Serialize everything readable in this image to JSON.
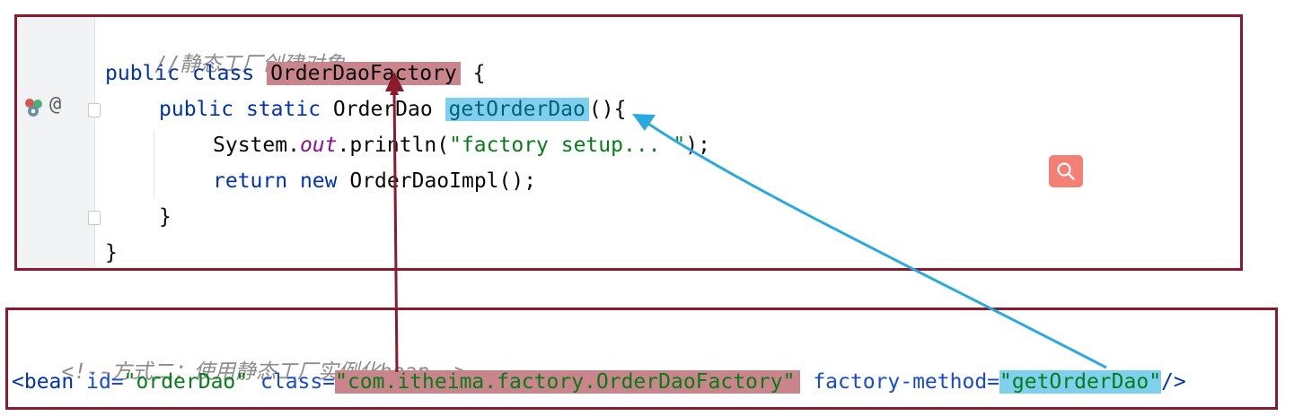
{
  "java": {
    "comment": "//静态工厂创建对象",
    "kw_public": "public",
    "kw_class": "class",
    "class_name": "OrderDaoFactory",
    "open_brace": " {",
    "kw_static": "static",
    "return_type": "OrderDao",
    "method_name": "getOrderDao",
    "method_parens": "(){",
    "system": "System.",
    "out": "out",
    "println_open": ".println(",
    "println_str": "\"factory setup... \"",
    "println_close": ");",
    "kw_return": "return",
    "kw_new": "new",
    "impl_call": "OrderDaoImpl();",
    "close_inner": "}",
    "close_outer": "}",
    "gutter_at": "@"
  },
  "xml": {
    "comment": "<!--方式二：使用静态工厂实例化bean-->",
    "tag_open": "<bean",
    "attr_id": "id=",
    "id_value": "\"orderDao\"",
    "attr_class": "class=",
    "class_value": "\"com.itheima.factory.OrderDaoFactory\"",
    "attr_factory_method": "factory-method=",
    "factory_method_value": "\"getOrderDao\"",
    "tag_close": "/>"
  },
  "colors": {
    "frame": "#8b1a2e",
    "highlight_red": "#c9848c",
    "highlight_blue": "#7fd0ef",
    "arrow_red": "#8b1a2e",
    "arrow_blue": "#2aa8e0",
    "search_button": "#f47f74"
  },
  "icons": {
    "search": "magnifier-icon",
    "bean": "spring-bean-icon"
  }
}
